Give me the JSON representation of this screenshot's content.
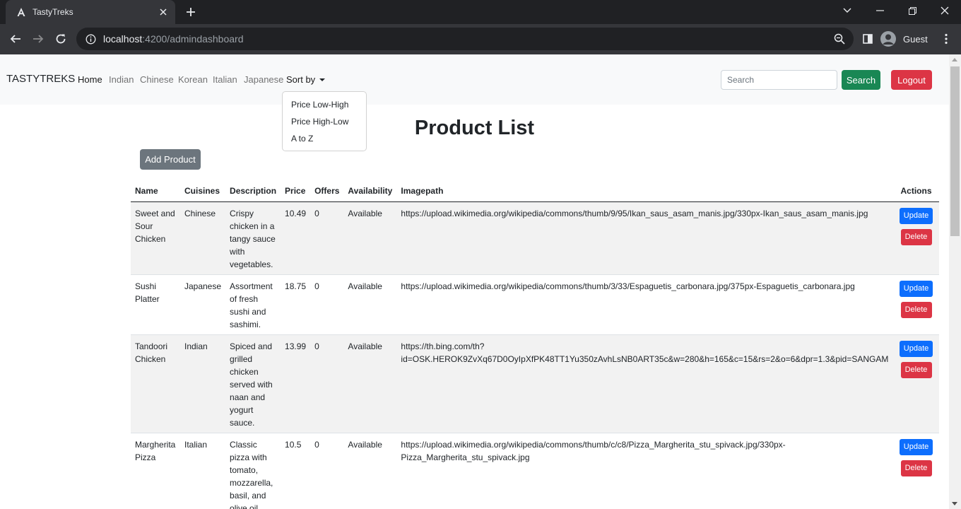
{
  "browser": {
    "tab_title": "TastyTreks",
    "url_host": "localhost",
    "url_rest": ":4200/admindashboard",
    "profile_name": "Guest"
  },
  "navbar": {
    "brand": "TASTYTREKS",
    "links": [
      "Home",
      "Indian",
      "Chinese",
      "Korean",
      "Italian",
      "Japanese"
    ],
    "sort_label": "Sort by",
    "sort_options": [
      "Price Low-High",
      "Price High-Low",
      "A to Z"
    ],
    "search_placeholder": "Search",
    "search_button": "Search",
    "logout_button": "Logout"
  },
  "main": {
    "title": "Product List",
    "add_button": "Add Product"
  },
  "table": {
    "headers": {
      "name": "Name",
      "cuisines": "Cuisines",
      "description": "Description",
      "price": "Price",
      "offers": "Offers",
      "availability": "Availability",
      "imagepath": "Imagepath",
      "actions": "Actions"
    },
    "update_label": "Update",
    "delete_label": "Delete",
    "rows": [
      {
        "name": "Sweet and Sour Chicken",
        "cuisine": "Chinese",
        "description": "Crispy chicken in a tangy sauce with vegetables.",
        "price": "10.49",
        "offers": "0",
        "availability": "Available",
        "imagepath": "https://upload.wikimedia.org/wikipedia/commons/thumb/9/95/Ikan_saus_asam_manis.jpg/330px-Ikan_saus_asam_manis.jpg"
      },
      {
        "name": "Sushi Platter",
        "cuisine": "Japanese",
        "description": "Assortment of fresh sushi and sashimi.",
        "price": "18.75",
        "offers": "0",
        "availability": "Available",
        "imagepath": "https://upload.wikimedia.org/wikipedia/commons/thumb/3/33/Espaguetis_carbonara.jpg/375px-Espaguetis_carbonara.jpg"
      },
      {
        "name": "Tandoori Chicken",
        "cuisine": "Indian",
        "description": "Spiced and grilled chicken served with naan and yogurt sauce.",
        "price": "13.99",
        "offers": "0",
        "availability": "Available",
        "imagepath": "https://th.bing.com/th?id=OSK.HEROK9ZvXq67D0OyIpXfPK48TT1Yu350zAvhLsNB0ART35c&w=280&h=165&c=15&rs=2&o=6&dpr=1.3&pid=SANGAM"
      },
      {
        "name": "Margherita Pizza",
        "cuisine": "Italian",
        "description": "Classic pizza with tomato, mozzarella, basil, and olive oil.",
        "price": "10.5",
        "offers": "0",
        "availability": "Available",
        "imagepath": "https://upload.wikimedia.org/wikipedia/commons/thumb/c/c8/Pizza_Margherita_stu_spivack.jpg/330px-Pizza_Margherita_stu_spivack.jpg"
      }
    ]
  },
  "colors": {
    "success": "#198754",
    "danger": "#dc3545",
    "primary": "#0d6efd",
    "secondary": "#6c757d"
  }
}
